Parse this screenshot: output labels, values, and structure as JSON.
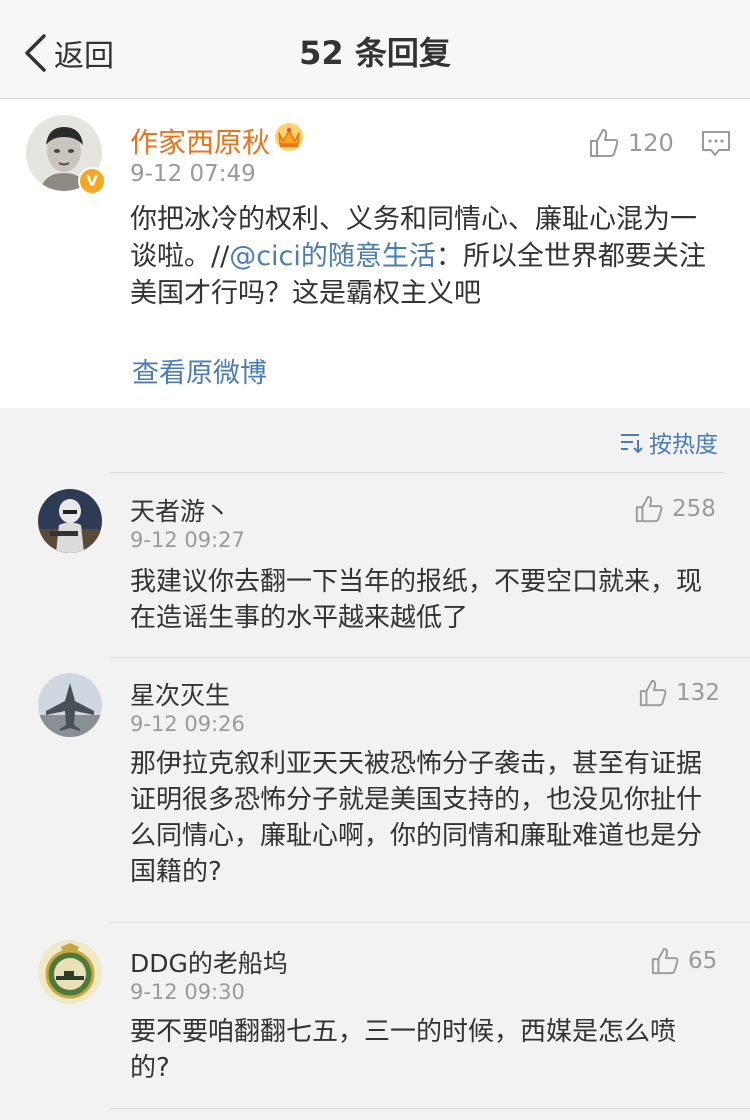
{
  "nav": {
    "back_label": "返回",
    "title": "52 条回复"
  },
  "post": {
    "author": "作家西原秋",
    "time": "9-12 07:49",
    "likes": "120",
    "verified_label": "V",
    "text_before": "你把冰冷的权利、义务和同情心、廉耻心混为一谈啦。//",
    "mention": "@cici的随意生活",
    "text_after": "：所以全世界都要关注美国才行吗？这是霸权主义吧",
    "view_original": "查看原微博"
  },
  "sort": {
    "label": "按热度"
  },
  "comments": [
    {
      "name": "天者游丶",
      "time": "9-12 09:27",
      "likes": "258",
      "text": "我建议你去翻一下当年的报纸，不要空口就来，现在造谣生事的水平越来越低了"
    },
    {
      "name": "星次灭生",
      "time": "9-12 09:26",
      "likes": "132",
      "text": "那伊拉克叙利亚天天被恐怖分子袭击，甚至有证据证明很多恐怖分子就是美国支持的，也没见你扯什么同情心，廉耻心啊，你的同情和廉耻难道也是分国籍的?"
    },
    {
      "name": "DDG的老船坞",
      "time": "9-12 09:30",
      "likes": "65",
      "text": "要不要咱翻翻七五，三一的时候，西媒是怎么喷的?"
    }
  ],
  "icons": {
    "back": "chevron-left-icon",
    "crown": "crown-icon",
    "like": "thumbs-up-icon",
    "comment": "comment-icon",
    "sort": "sort-icon"
  },
  "colors": {
    "author_orange": "#e8741e",
    "link_blue": "#4a7db5",
    "meta_gray": "#9a9a9a",
    "verified_gold": "#f5a623"
  }
}
